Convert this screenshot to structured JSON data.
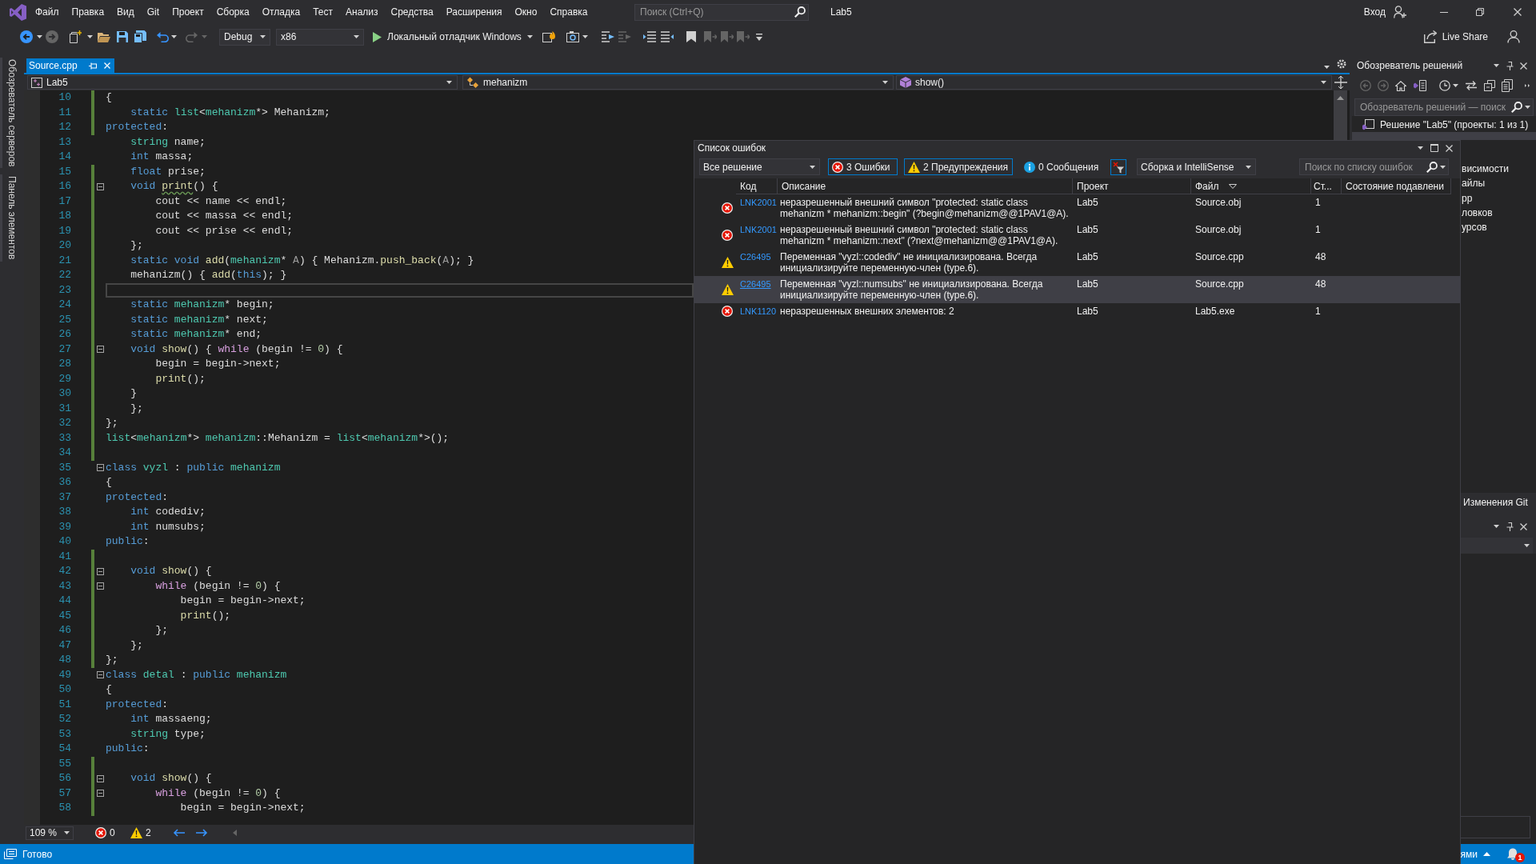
{
  "menu_bar": {
    "items": [
      "Файл",
      "Правка",
      "Вид",
      "Git",
      "Проект",
      "Сборка",
      "Отладка",
      "Тест",
      "Анализ",
      "Средства",
      "Расширения",
      "Окно",
      "Справка"
    ],
    "search": {
      "placeholder": "Поиск (Ctrl+Q)"
    },
    "solution_name": "Lab5",
    "account": "Вход"
  },
  "toolbar": {
    "configuration": "Debug",
    "platform": "x86",
    "debugger": "Локальный отладчик Windows",
    "live_share": "Live Share"
  },
  "side_tabs": [
    "Обозреватель серверов",
    "Панель элементов"
  ],
  "editor": {
    "tabs": [
      {
        "label": "Source.cpp",
        "selected": true
      }
    ],
    "navigation": [
      {
        "kind": "project",
        "label": "Lab5"
      },
      {
        "kind": "class",
        "label": "mehanizm"
      },
      {
        "kind": "method",
        "label": "show()"
      }
    ],
    "lines": [
      {
        "number": "10",
        "changed": true,
        "collapsible": false,
        "current": false,
        "tokens": [
          {
            "kind": "plain",
            "text": "{"
          }
        ]
      },
      {
        "number": "11",
        "changed": true,
        "collapsible": false,
        "current": false,
        "tokens": [
          {
            "kind": "keyword",
            "text": "    static "
          },
          {
            "kind": "type",
            "text": "list"
          },
          {
            "kind": "plain",
            "text": "<"
          },
          {
            "kind": "type",
            "text": "mehanizm"
          },
          {
            "kind": "plain",
            "text": "*> Mehanizm;"
          }
        ]
      },
      {
        "number": "12",
        "changed": true,
        "collapsible": false,
        "current": false,
        "tokens": [
          {
            "kind": "keyword",
            "text": "protected"
          },
          {
            "kind": "plain",
            "text": ":"
          }
        ]
      },
      {
        "number": "13",
        "changed": false,
        "collapsible": false,
        "current": false,
        "tokens": [
          {
            "kind": "type",
            "text": "    string"
          },
          {
            "kind": "plain",
            "text": " name;"
          }
        ]
      },
      {
        "number": "14",
        "changed": false,
        "collapsible": false,
        "current": false,
        "tokens": [
          {
            "kind": "keyword",
            "text": "    int"
          },
          {
            "kind": "plain",
            "text": " massa;"
          }
        ]
      },
      {
        "number": "15",
        "changed": true,
        "collapsible": false,
        "current": false,
        "tokens": [
          {
            "kind": "keyword",
            "text": "    float"
          },
          {
            "kind": "plain",
            "text": " prise;"
          }
        ]
      },
      {
        "number": "16",
        "changed": true,
        "collapsible": true,
        "current": false,
        "tokens": [
          {
            "kind": "keyword",
            "text": "    void "
          },
          {
            "kind": "function",
            "text": "print",
            "squiggle": true
          },
          {
            "kind": "plain",
            "text": "() {"
          }
        ]
      },
      {
        "number": "17",
        "changed": true,
        "collapsible": false,
        "current": false,
        "tokens": [
          {
            "kind": "plain",
            "text": "        cout << name << endl;"
          }
        ]
      },
      {
        "number": "18",
        "changed": true,
        "collapsible": false,
        "current": false,
        "tokens": [
          {
            "kind": "plain",
            "text": "        cout << massa << endl;"
          }
        ]
      },
      {
        "number": "19",
        "changed": true,
        "collapsible": false,
        "current": false,
        "tokens": [
          {
            "kind": "plain",
            "text": "        cout << prise << endl;"
          }
        ]
      },
      {
        "number": "20",
        "changed": true,
        "collapsible": false,
        "current": false,
        "tokens": [
          {
            "kind": "plain",
            "text": "    };"
          }
        ]
      },
      {
        "number": "21",
        "changed": true,
        "collapsible": false,
        "current": false,
        "tokens": [
          {
            "kind": "keyword",
            "text": "    static void "
          },
          {
            "kind": "function",
            "text": "add"
          },
          {
            "kind": "plain",
            "text": "("
          },
          {
            "kind": "type",
            "text": "mehanizm"
          },
          {
            "kind": "plain",
            "text": "* "
          },
          {
            "kind": "parameter",
            "text": "A"
          },
          {
            "kind": "plain",
            "text": ") { Mehanizm."
          },
          {
            "kind": "function",
            "text": "push_back"
          },
          {
            "kind": "plain",
            "text": "("
          },
          {
            "kind": "parameter",
            "text": "A"
          },
          {
            "kind": "plain",
            "text": "); }"
          }
        ]
      },
      {
        "number": "22",
        "changed": true,
        "collapsible": false,
        "current": false,
        "tokens": [
          {
            "kind": "plain",
            "text": "    mehanizm() { "
          },
          {
            "kind": "function",
            "text": "add"
          },
          {
            "kind": "plain",
            "text": "("
          },
          {
            "kind": "keyword",
            "text": "this"
          },
          {
            "kind": "plain",
            "text": "); }"
          }
        ]
      },
      {
        "number": "23",
        "changed": true,
        "collapsible": false,
        "current": true
      },
      {
        "number": "24",
        "changed": true,
        "collapsible": false,
        "current": false,
        "tokens": [
          {
            "kind": "keyword",
            "text": "    static "
          },
          {
            "kind": "type",
            "text": "mehanizm"
          },
          {
            "kind": "plain",
            "text": "* begin;"
          }
        ]
      },
      {
        "number": "25",
        "changed": true,
        "collapsible": false,
        "current": false,
        "tokens": [
          {
            "kind": "keyword",
            "text": "    static "
          },
          {
            "kind": "type",
            "text": "mehanizm"
          },
          {
            "kind": "plain",
            "text": "* next;"
          }
        ]
      },
      {
        "number": "26",
        "changed": true,
        "collapsible": false,
        "current": false,
        "tokens": [
          {
            "kind": "keyword",
            "text": "    static "
          },
          {
            "kind": "type",
            "text": "mehanizm"
          },
          {
            "kind": "plain",
            "text": "* end;"
          }
        ]
      },
      {
        "number": "27",
        "changed": true,
        "collapsible": true,
        "current": false,
        "tokens": [
          {
            "kind": "keyword",
            "text": "    void "
          },
          {
            "kind": "function",
            "text": "show"
          },
          {
            "kind": "plain",
            "text": "() { "
          },
          {
            "kind": "control",
            "text": "while"
          },
          {
            "kind": "plain",
            "text": " (begin != "
          },
          {
            "kind": "number",
            "text": "0"
          },
          {
            "kind": "plain",
            "text": ") {"
          }
        ]
      },
      {
        "number": "28",
        "changed": true,
        "collapsible": false,
        "current": false,
        "tokens": [
          {
            "kind": "plain",
            "text": "        begin = begin->next;"
          }
        ]
      },
      {
        "number": "29",
        "changed": true,
        "collapsible": false,
        "current": false,
        "tokens": [
          {
            "kind": "function",
            "text": "        print"
          },
          {
            "kind": "plain",
            "text": "();"
          }
        ]
      },
      {
        "number": "30",
        "changed": true,
        "collapsible": false,
        "current": false,
        "tokens": [
          {
            "kind": "plain",
            "text": "    }"
          }
        ]
      },
      {
        "number": "31",
        "changed": true,
        "collapsible": false,
        "current": false,
        "tokens": [
          {
            "kind": "plain",
            "text": "    };"
          }
        ]
      },
      {
        "number": "32",
        "changed": true,
        "collapsible": false,
        "current": false,
        "tokens": [
          {
            "kind": "plain",
            "text": "};"
          }
        ]
      },
      {
        "number": "33",
        "changed": true,
        "collapsible": false,
        "current": false,
        "tokens": [
          {
            "kind": "type",
            "text": "list"
          },
          {
            "kind": "plain",
            "text": "<"
          },
          {
            "kind": "type",
            "text": "mehanizm"
          },
          {
            "kind": "plain",
            "text": "*> "
          },
          {
            "kind": "type",
            "text": "mehanizm"
          },
          {
            "kind": "plain",
            "text": "::Mehanizm = "
          },
          {
            "kind": "type",
            "text": "list"
          },
          {
            "kind": "plain",
            "text": "<"
          },
          {
            "kind": "type",
            "text": "mehanizm"
          },
          {
            "kind": "plain",
            "text": "*>();"
          }
        ]
      },
      {
        "number": "34",
        "changed": true,
        "collapsible": false,
        "current": false
      },
      {
        "number": "35",
        "changed": false,
        "collapsible": true,
        "current": false,
        "tokens": [
          {
            "kind": "keyword",
            "text": "class "
          },
          {
            "kind": "type",
            "text": "vyzl"
          },
          {
            "kind": "plain",
            "text": " : "
          },
          {
            "kind": "keyword",
            "text": "public "
          },
          {
            "kind": "type",
            "text": "mehanizm"
          }
        ]
      },
      {
        "number": "36",
        "changed": false,
        "collapsible": false,
        "current": false,
        "tokens": [
          {
            "kind": "plain",
            "text": "{"
          }
        ]
      },
      {
        "number": "37",
        "changed": false,
        "collapsible": false,
        "current": false,
        "tokens": [
          {
            "kind": "keyword",
            "text": "protected"
          },
          {
            "kind": "plain",
            "text": ":"
          }
        ]
      },
      {
        "number": "38",
        "changed": false,
        "collapsible": false,
        "current": false,
        "tokens": [
          {
            "kind": "keyword",
            "text": "    int"
          },
          {
            "kind": "plain",
            "text": " codediv;"
          }
        ]
      },
      {
        "number": "39",
        "changed": false,
        "collapsible": false,
        "current": false,
        "tokens": [
          {
            "kind": "keyword",
            "text": "    int"
          },
          {
            "kind": "plain",
            "text": " numsubs;"
          }
        ]
      },
      {
        "number": "40",
        "changed": false,
        "collapsible": false,
        "current": false,
        "tokens": [
          {
            "kind": "keyword",
            "text": "public"
          },
          {
            "kind": "plain",
            "text": ":"
          }
        ]
      },
      {
        "number": "41",
        "changed": true,
        "collapsible": false,
        "current": false
      },
      {
        "number": "42",
        "changed": true,
        "collapsible": true,
        "current": false,
        "tokens": [
          {
            "kind": "keyword",
            "text": "    void "
          },
          {
            "kind": "function",
            "text": "show"
          },
          {
            "kind": "plain",
            "text": "() {"
          }
        ]
      },
      {
        "number": "43",
        "changed": true,
        "collapsible": true,
        "current": false,
        "tokens": [
          {
            "kind": "control",
            "text": "        while"
          },
          {
            "kind": "plain",
            "text": " (begin != "
          },
          {
            "kind": "number",
            "text": "0"
          },
          {
            "kind": "plain",
            "text": ") {"
          }
        ]
      },
      {
        "number": "44",
        "changed": true,
        "collapsible": false,
        "current": false,
        "tokens": [
          {
            "kind": "plain",
            "text": "            begin = begin->next;"
          }
        ]
      },
      {
        "number": "45",
        "changed": true,
        "collapsible": false,
        "current": false,
        "tokens": [
          {
            "kind": "function",
            "text": "            print"
          },
          {
            "kind": "plain",
            "text": "();"
          }
        ]
      },
      {
        "number": "46",
        "changed": true,
        "collapsible": false,
        "current": false,
        "tokens": [
          {
            "kind": "plain",
            "text": "        };"
          }
        ]
      },
      {
        "number": "47",
        "changed": true,
        "collapsible": false,
        "current": false,
        "tokens": [
          {
            "kind": "plain",
            "text": "    };"
          }
        ]
      },
      {
        "number": "48",
        "changed": true,
        "collapsible": false,
        "current": false,
        "tokens": [
          {
            "kind": "plain",
            "text": "};"
          }
        ]
      },
      {
        "number": "49",
        "changed": false,
        "collapsible": true,
        "current": false,
        "tokens": [
          {
            "kind": "keyword",
            "text": "class "
          },
          {
            "kind": "type",
            "text": "detal"
          },
          {
            "kind": "plain",
            "text": " : "
          },
          {
            "kind": "keyword",
            "text": "public "
          },
          {
            "kind": "type",
            "text": "mehanizm"
          }
        ]
      },
      {
        "number": "50",
        "changed": false,
        "collapsible": false,
        "current": false,
        "tokens": [
          {
            "kind": "plain",
            "text": "{"
          }
        ]
      },
      {
        "number": "51",
        "changed": false,
        "collapsible": false,
        "current": false,
        "tokens": [
          {
            "kind": "keyword",
            "text": "protected"
          },
          {
            "kind": "plain",
            "text": ":"
          }
        ]
      },
      {
        "number": "52",
        "changed": false,
        "collapsible": false,
        "current": false,
        "tokens": [
          {
            "kind": "keyword",
            "text": "    int"
          },
          {
            "kind": "plain",
            "text": " massaeng;"
          }
        ]
      },
      {
        "number": "53",
        "changed": false,
        "collapsible": false,
        "current": false,
        "tokens": [
          {
            "kind": "type",
            "text": "    string"
          },
          {
            "kind": "plain",
            "text": " type;"
          }
        ]
      },
      {
        "number": "54",
        "changed": false,
        "collapsible": false,
        "current": false,
        "tokens": [
          {
            "kind": "keyword",
            "text": "public"
          },
          {
            "kind": "plain",
            "text": ":"
          }
        ]
      },
      {
        "number": "55",
        "changed": true,
        "collapsible": false,
        "current": false
      },
      {
        "number": "56",
        "changed": true,
        "collapsible": true,
        "current": false,
        "tokens": [
          {
            "kind": "keyword",
            "text": "    void "
          },
          {
            "kind": "function",
            "text": "show"
          },
          {
            "kind": "plain",
            "text": "() {"
          }
        ]
      },
      {
        "number": "57",
        "changed": true,
        "collapsible": true,
        "current": false,
        "tokens": [
          {
            "kind": "control",
            "text": "        while"
          },
          {
            "kind": "plain",
            "text": " (begin != "
          },
          {
            "kind": "number",
            "text": "0"
          },
          {
            "kind": "plain",
            "text": ") {"
          }
        ]
      },
      {
        "number": "58",
        "changed": true,
        "collapsible": false,
        "current": false,
        "tokens": [
          {
            "kind": "plain",
            "text": "            begin = begin->next;"
          }
        ]
      }
    ],
    "zoom": "109 %",
    "error_count": "0",
    "warning_count": "2"
  },
  "error_list": {
    "title": "Список ошибок",
    "scope": "Все решение",
    "filters": [
      {
        "kind": "error",
        "label": "3 Ошибки",
        "selected": true
      },
      {
        "kind": "warning",
        "label": "2 Предупреждения",
        "selected": true
      },
      {
        "kind": "info",
        "label": "0 Сообщения",
        "selected": false
      }
    ],
    "source": "Сборка и IntelliSense",
    "search": {
      "placeholder": "Поиск по списку ошибок"
    },
    "columns": [
      {
        "label": "Код",
        "sorted": false
      },
      {
        "label": "Описание",
        "sorted": false
      },
      {
        "label": "Проект",
        "sorted": false
      },
      {
        "label": "Файл",
        "sorted": true
      },
      {
        "label": "Ст...",
        "sorted": false
      },
      {
        "label": "Состояние подавлени",
        "sorted": false
      }
    ],
    "rows": [
      {
        "kind": "error",
        "code": "LNK2001",
        "description": "неразрешенный внешний символ \"protected: static class mehanizm * mehanizm::begin\" (?begin@mehanizm@@1PAV1@A).",
        "project": "Lab5",
        "file": "Source.obj",
        "line": "1",
        "selected": false
      },
      {
        "kind": "error",
        "code": "LNK2001",
        "description": "неразрешенный внешний символ \"protected: static class mehanizm * mehanizm::next\" (?next@mehanizm@@1PAV1@A).",
        "project": "Lab5",
        "file": "Source.obj",
        "line": "1",
        "selected": false
      },
      {
        "kind": "warning",
        "code": "C26495",
        "description": "Переменная \"vyzl::codediv\" не инициализирована. Всегда инициализируйте переменную-член (type.6).",
        "project": "Lab5",
        "file": "Source.cpp",
        "line": "48",
        "selected": false
      },
      {
        "kind": "warning",
        "code": "C26495",
        "description": "Переменная \"vyzl::numsubs\" не инициализирована. Всегда инициализируйте переменную-член (type.6).",
        "project": "Lab5",
        "file": "Source.cpp",
        "line": "48",
        "selected": true
      },
      {
        "kind": "error",
        "code": "LNK1120",
        "description": "неразрешенных внешних элементов: 2",
        "project": "Lab5",
        "file": "Lab5.exe",
        "line": "1",
        "selected": false
      }
    ]
  },
  "solution_explorer": {
    "title": "Обозреватель решений",
    "search": {
      "placeholder": "Обозреватель решений — поиск"
    },
    "tree": [
      {
        "kind": "solution",
        "label": "Решение \"Lab5\" (проекты: 1 из 1)",
        "selected": false
      },
      {
        "kind": "project",
        "selected": true
      },
      {
        "kind": "partial",
        "label": "висимости",
        "selected": false
      },
      {
        "kind": "partial",
        "label": "айлы",
        "selected": false
      },
      {
        "kind": "partial",
        "label": "pp",
        "selected": false
      },
      {
        "kind": "partial",
        "label": "ловков",
        "selected": false
      },
      {
        "kind": "partial",
        "label": "урсов",
        "selected": false
      }
    ],
    "bottom_tabs": [
      {
        "label": "Изменения Git",
        "selected": false
      }
    ]
  },
  "status_bar": {
    "text": "Готово",
    "right_text": "ями",
    "notification_count": "1"
  }
}
